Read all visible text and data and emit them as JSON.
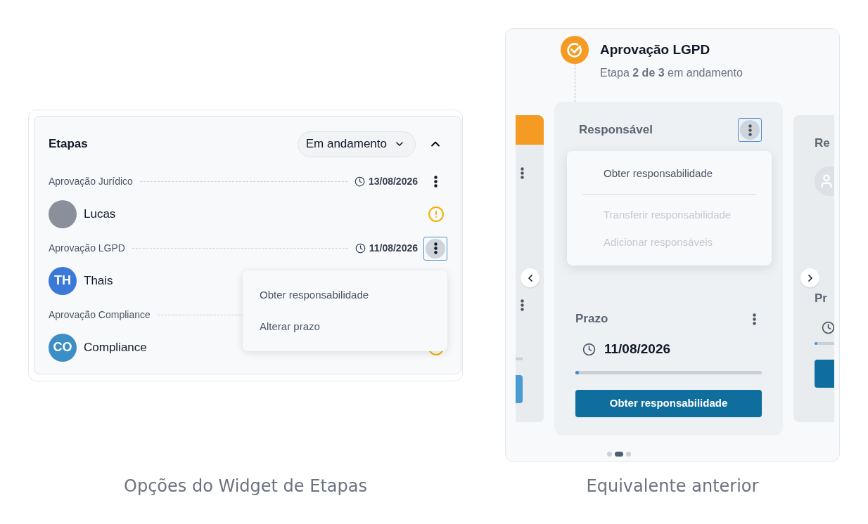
{
  "widget": {
    "title": "Etapas",
    "status_filter": "Em andamento",
    "expanded": true,
    "steps": [
      {
        "name": "Aprovação Jurídico",
        "date": "13/08/2026",
        "menu_open": false,
        "warning": true,
        "assignee": {
          "name": "Lucas"
        }
      },
      {
        "name": "Aprovação LGPD",
        "date": "11/08/2026",
        "menu_open": true,
        "assignee": {
          "name": "Thais",
          "initials": "TH",
          "color": "#3b78d8"
        }
      },
      {
        "name": "Aprovação Compliance",
        "menu_open": false,
        "warning": true,
        "assignee": {
          "name": "Compliance",
          "initials": "CO",
          "color": "#3d8ec6"
        }
      }
    ],
    "menu": {
      "items": [
        {
          "label": "Obter responsabilidade"
        },
        {
          "label": "Alterar prazo"
        }
      ]
    },
    "caption": "Opções do Widget de Etapas"
  },
  "legacy": {
    "step": {
      "title": "Aprovação LGPD",
      "subtitle": "Etapa **2 de 3** em andamento"
    },
    "current_card": {
      "responsible_label": "Responsável",
      "menu_open": true,
      "menu": {
        "items": [
          {
            "label": "Obter responsabilidade",
            "disabled": false
          },
          {
            "label": "Transferir responsabilidade",
            "disabled": true
          },
          {
            "label": "Adicionar responsáveis",
            "disabled": true
          }
        ]
      },
      "deadline_label": "Prazo",
      "date": "11/08/2026",
      "level": 0.02,
      "button": "Obter responsabilidade"
    },
    "next_card": {
      "responsible_label": "Re",
      "deadline_label": "Pr",
      "level": 0.02
    },
    "pages": [
      {
        "selected": false
      },
      {
        "selected": true
      },
      {
        "selected": false
      }
    ],
    "caption": "Equivalente anterior"
  }
}
